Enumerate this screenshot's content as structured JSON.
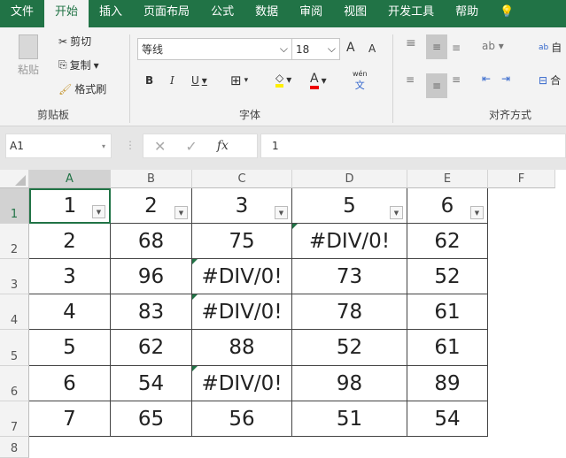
{
  "tabs": [
    "文件",
    "开始",
    "插入",
    "页面布局",
    "公式",
    "数据",
    "审阅",
    "视图",
    "开发工具",
    "帮助"
  ],
  "ribbon": {
    "paste": "粘贴",
    "cut": "剪切",
    "copy": "复制",
    "format_painter": "格式刷",
    "clipboard": "剪贴板",
    "font_name": "等线",
    "font_size": "18",
    "font_group": "字体",
    "bold": "B",
    "italic": "I",
    "underline": "U",
    "font_color": "A",
    "grow": "A",
    "shrink": "A",
    "phonetic": "wén",
    "phonetic_char": "文",
    "align_group": "对齐方式",
    "wrap": "自",
    "merge": "合"
  },
  "formula_bar": {
    "name_box": "A1",
    "fx": "fx",
    "value": "1"
  },
  "columns": [
    "A",
    "B",
    "C",
    "D",
    "E",
    "F"
  ],
  "rows": [
    "1",
    "2",
    "3",
    "4",
    "5",
    "6",
    "7",
    "8"
  ],
  "cells": [
    [
      "1",
      "2",
      "3",
      "5",
      "6"
    ],
    [
      "2",
      "68",
      "75",
      "#DIV/0!",
      "62"
    ],
    [
      "3",
      "96",
      "#DIV/0!",
      "73",
      "52"
    ],
    [
      "4",
      "83",
      "#DIV/0!",
      "78",
      "61"
    ],
    [
      "5",
      "62",
      "88",
      "52",
      "61"
    ],
    [
      "6",
      "54",
      "#DIV/0!",
      "98",
      "89"
    ],
    [
      "7",
      "65",
      "56",
      "51",
      "54"
    ]
  ],
  "colors": {
    "accent": "#217346"
  }
}
